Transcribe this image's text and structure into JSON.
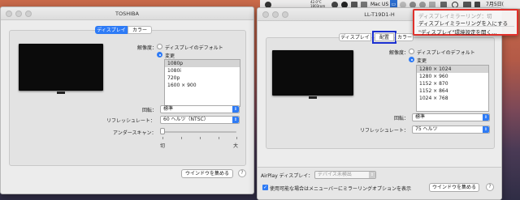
{
  "menubar": {
    "battery_line1": "42.0°C",
    "battery_line2": "1803rpm",
    "mac_us": "Mac US",
    "date_partial": "7月5日("
  },
  "dropdown": {
    "mirroring_off": "ディスプレイミラーリング：切",
    "mirroring_on": "ディスプレイミラーリングを入にする",
    "open_prefs": "\"ディスプレイ\"環境設定を開く…"
  },
  "left_window": {
    "title": "TOSHIBA",
    "tabs": [
      "ディスプレイ",
      "カラー"
    ],
    "resolution_label": "解像度：",
    "radio_default": "ディスプレイのデフォルト",
    "radio_scaled": "変更",
    "resolutions": [
      "1080p",
      "1080i",
      "720p",
      "1600 × 900"
    ],
    "rotation_label": "回転：",
    "rotation_value": "標準",
    "refresh_label": "リフレッシュレート：",
    "refresh_value": "60 ヘルツ（NTSC）",
    "underscan_label": "アンダースキャン：",
    "underscan_min": "切",
    "underscan_max": "大",
    "underscan_level": 0,
    "gather_button": "ウインドウを集める",
    "help": "?"
  },
  "right_window": {
    "title": "LL-T19D1-H",
    "tabs": [
      "ディスプレイ",
      "配置",
      "カラー"
    ],
    "resolution_label": "解像度：",
    "radio_default": "ディスプレイのデフォルト",
    "radio_scaled": "変更",
    "resolutions": [
      "1280 × 1024",
      "1280 × 960",
      "1152 × 870",
      "1152 × 864",
      "1024 × 768"
    ],
    "rotation_label": "回転：",
    "rotation_value": "標準",
    "refresh_label": "リフレッシュレート：",
    "refresh_value": "75 ヘルツ",
    "airplay_label": "AirPlay ディスプレイ：",
    "airplay_value": "デバイス未検出",
    "show_menu_checkbox": "使用可能な場合はメニューバーにミラーリングオプションを表示",
    "gather_button": "ウインドウを集める",
    "help": "?"
  }
}
